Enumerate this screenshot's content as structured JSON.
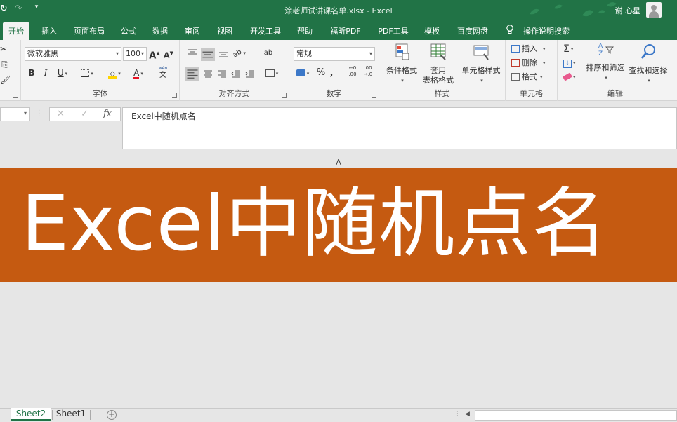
{
  "window": {
    "title": "涂老师试讲课名单.xlsx  -  Excel",
    "user": "谢 心星"
  },
  "quick_access": {
    "icons": [
      "redo-arrow-icon",
      "undo-dropdown-icon",
      "customize-qat-icon"
    ]
  },
  "tabs": [
    {
      "label": "开始",
      "active": true
    },
    {
      "label": "插入"
    },
    {
      "label": "页面布局"
    },
    {
      "label": "公式"
    },
    {
      "label": "数据"
    },
    {
      "label": "审阅"
    },
    {
      "label": "视图"
    },
    {
      "label": "开发工具"
    },
    {
      "label": "帮助"
    },
    {
      "label": "福昕PDF"
    },
    {
      "label": "PDF工具"
    },
    {
      "label": "模板"
    },
    {
      "label": "百度网盘"
    }
  ],
  "tell_me": "操作说明搜索",
  "ribbon": {
    "font": {
      "label": "字体",
      "font_name": "微软雅黑",
      "font_size": "100",
      "grow": "A",
      "shrink": "A",
      "bold": "B",
      "italic": "I",
      "underline": "U",
      "wen": "wén",
      "wen_char": "文",
      "font_color_letter": "A"
    },
    "alignment": {
      "label": "对齐方式",
      "rotate": "ab",
      "wrap": "ab"
    },
    "number": {
      "label": "数字",
      "format": "常规",
      "percent": "%",
      "comma": "，",
      "inc_decimal_top": "←0",
      "inc_decimal_bottom": ".00",
      "dec_decimal_top": ".00",
      "dec_decimal_bottom": "→.0"
    },
    "styles": {
      "label": "样式",
      "conditional": "条件格式",
      "table_format_1": "套用",
      "table_format_2": "表格格式",
      "cell_style": "单元格样式"
    },
    "cells": {
      "label": "单元格",
      "insert": "插入",
      "delete": "删除",
      "format": "格式"
    },
    "editing": {
      "label": "编辑",
      "sort": "排序和筛选",
      "find": "查找和选择",
      "sum": "Σ",
      "az_top": "A",
      "az_bottom": "Z"
    }
  },
  "formula_bar": {
    "name_box": "",
    "cancel": "✕",
    "enter": "✓",
    "fx": "fx",
    "content": "Excel中随机点名"
  },
  "sheet": {
    "column": "A",
    "banner_text": "Excel中随机点名",
    "banner_color": "#c55a11"
  },
  "sheet_tabs": [
    {
      "label": "Sheet2",
      "active": true
    },
    {
      "label": "Sheet1"
    }
  ],
  "add_sheet": "+",
  "colors": {
    "excel_green": "#217346",
    "ribbon_bg": "#f3f3f3"
  }
}
